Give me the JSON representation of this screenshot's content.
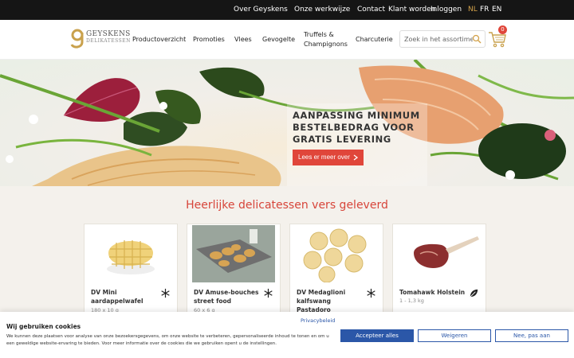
{
  "topbar": {
    "links": [
      "Over Geyskens",
      "Onze werkwijze",
      "Contact",
      "Klant worden",
      "Inloggen"
    ],
    "languages": [
      "NL",
      "FR",
      "EN"
    ],
    "active_language": "NL"
  },
  "logo": {
    "name": "GEYSKENS",
    "subtitle": "DELIKATESSEN"
  },
  "nav": {
    "items": [
      "Productoverzicht",
      "Promoties",
      "Vlees",
      "Gevogelte",
      "Truffels &",
      "Champignons",
      "Charcuterie"
    ]
  },
  "search": {
    "placeholder": "Zoek in het assortiment"
  },
  "cart": {
    "count": "0"
  },
  "hero": {
    "title_lines": [
      "AANPASSING MINIMUM",
      "BESTELBEDRAG VOOR",
      "GRATIS LEVERING"
    ],
    "button_label": "Lees er meer over"
  },
  "section": {
    "title": "Heerlijke delicatessen vers geleverd"
  },
  "products": [
    {
      "name": "DV Mini aardappelwafel",
      "qty": "180 x 10 g",
      "icon": "snowflake-icon"
    },
    {
      "name": "DV Amuse-bouches street food",
      "qty": "60 x 6 g",
      "icon": "snowflake-icon"
    },
    {
      "name": "DV Medaglioni kalfswang Pastadoro",
      "qty": "",
      "icon": "snowflake-icon"
    },
    {
      "name": "Tomahawk Holstein",
      "qty": "1 - 1,3 kg",
      "icon": "leaf-icon"
    }
  ],
  "cookie": {
    "privacy_link": "Privacybeleid",
    "title": "Wij gebruiken cookies",
    "text": "We kunnen deze plaatsen voor analyse van onze bezoekersgegevens, om onze website te verbeteren, gepersonaliseerde inhoud te tonen en om u een geweldige website-ervaring te bieden. Voor meer informatie over de cookies die we gebruiken opent u de instellingen.",
    "accept_label": "Accepteer alles",
    "decline_label": "Weigeren",
    "no_label": "Nee, pas aan"
  },
  "colors": {
    "accent": "#e0463a",
    "gold": "#d3a24a",
    "topbar": "#151515",
    "cookie_blue": "#2b57a8"
  }
}
